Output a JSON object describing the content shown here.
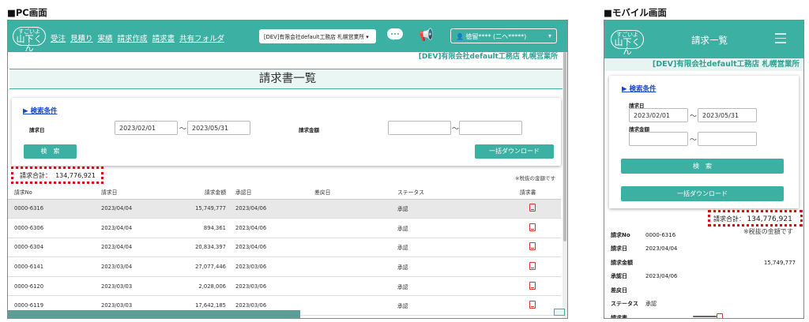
{
  "labels": {
    "pc": "■PC画面",
    "mobile": "■モバイル画面"
  },
  "logo": {
    "top": "すごいよ",
    "main": "山下くん"
  },
  "pc": {
    "menu": [
      "受注",
      "見積り",
      "実績",
      "請求作成",
      "請求書",
      "共有フォルダ"
    ],
    "company_select": "[DEV]有限会社default工務店 札幌営業所",
    "user": "徳留**** (二ヘ*****)",
    "company_line": "[DEV]有限会社default工務店 札幌営業所",
    "title": "請求書一覧",
    "search": {
      "link": "▶ 検索条件",
      "date_label": "請求日",
      "date_from": "2023/02/01",
      "date_to": "2023/05/31",
      "tilde": "～",
      "amount_label": "請求金額",
      "search_btn": "検　索",
      "download_btn": "一括ダウンロード"
    },
    "total": {
      "label": "請求合計：",
      "value": "134,776,921"
    },
    "note": "※税抜の金額です",
    "table": {
      "headers": [
        "請求No",
        "請求日",
        "請求金額",
        "承認日",
        "差戻日",
        "ステータス",
        "請求書"
      ],
      "rows": [
        {
          "no": "0000-6316",
          "date": "2023/04/04",
          "amount": "15,749,777",
          "approved": "2023/04/06",
          "returned": "",
          "status": "承認"
        },
        {
          "no": "0000-6306",
          "date": "2023/04/04",
          "amount": "894,361",
          "approved": "2023/04/06",
          "returned": "",
          "status": "承認"
        },
        {
          "no": "0000-6304",
          "date": "2023/04/04",
          "amount": "20,834,397",
          "approved": "2023/04/06",
          "returned": "",
          "status": "承認"
        },
        {
          "no": "0000-6141",
          "date": "2023/03/04",
          "amount": "27,077,446",
          "approved": "2023/03/06",
          "returned": "",
          "status": "承認"
        },
        {
          "no": "0000-6120",
          "date": "2023/03/03",
          "amount": "2,028,006",
          "approved": "2023/03/06",
          "returned": "",
          "status": "承認"
        },
        {
          "no": "0000-6119",
          "date": "2023/03/03",
          "amount": "17,642,185",
          "approved": "2023/03/06",
          "returned": "",
          "status": "承認"
        }
      ]
    }
  },
  "mobile": {
    "title": "請求一覧",
    "company_line": "[DEV]有限会社default工務店 札幌営業所",
    "search": {
      "link": "▶ 検索条件",
      "date_label": "請求日",
      "date_from": "2023/02/01",
      "date_to": "2023/05/31",
      "tilde": "～",
      "amount_label": "請求金額",
      "search_btn": "検　索",
      "download_btn": "一括ダウンロード"
    },
    "total": {
      "label": "請求合計：",
      "value": "134,776,921"
    },
    "note": "※税抜の金額です",
    "detail": [
      {
        "k": "請求No",
        "v": "0000-6316"
      },
      {
        "k": "請求日",
        "v": "2023/04/04"
      },
      {
        "k": "請求金額",
        "v": "15,749,777"
      },
      {
        "k": "承認日",
        "v": "2023/04/06"
      },
      {
        "k": "差戻日",
        "v": ""
      },
      {
        "k": "ステータス",
        "v": "承認"
      },
      {
        "k": "請求書",
        "v": ""
      }
    ]
  },
  "colors": {
    "accent": "#3cb0a2",
    "total_border": "#d01414",
    "link": "#1a49c7"
  }
}
